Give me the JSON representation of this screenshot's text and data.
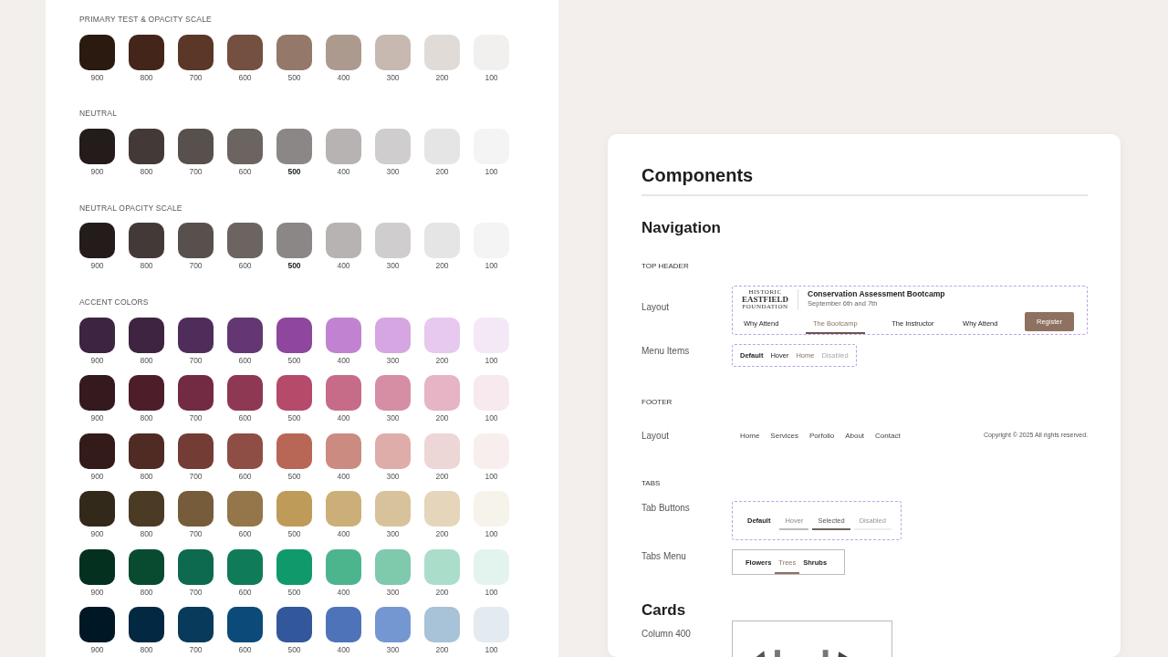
{
  "palette": [
    {
      "title": "PRIMARY  TEST & OPACITY SCALE",
      "rows": [
        [
          {
            "label": "900",
            "color": "#2b1a10",
            "bold": false
          },
          {
            "label": "800",
            "color": "#432619",
            "bold": false
          },
          {
            "label": "700",
            "color": "#5a3726",
            "bold": false
          },
          {
            "label": "600",
            "color": "#73503f",
            "bold": false
          },
          {
            "label": "500",
            "color": "#94786a",
            "bold": false
          },
          {
            "label": "400",
            "color": "#ad9a8e",
            "bold": false
          },
          {
            "label": "300",
            "color": "#c7b9b0",
            "bold": false
          },
          {
            "label": "200",
            "color": "#e0dbd7",
            "bold": false
          },
          {
            "label": "100",
            "color": "#f1f0ef",
            "bold": false
          }
        ]
      ]
    },
    {
      "title": "NEUTRAL",
      "rows": [
        [
          {
            "label": "900",
            "color": "#241c1b",
            "bold": false
          },
          {
            "label": "800",
            "color": "#433a38",
            "bold": false
          },
          {
            "label": "700",
            "color": "#58504d",
            "bold": false
          },
          {
            "label": "600",
            "color": "#6b6461",
            "bold": false
          },
          {
            "label": "500",
            "color": "#8b8786",
            "bold": true
          },
          {
            "label": "400",
            "color": "#b6b3b2",
            "bold": false
          },
          {
            "label": "300",
            "color": "#cfcdcd",
            "bold": false
          },
          {
            "label": "200",
            "color": "#e6e5e6",
            "bold": false
          },
          {
            "label": "100",
            "color": "#f5f4f5",
            "bold": false
          }
        ]
      ]
    },
    {
      "title": "NEUTRAL OPACITY SCALE",
      "rows": [
        [
          {
            "label": "900",
            "color": "#241c1b",
            "bold": false
          },
          {
            "label": "800",
            "color": "#433a38",
            "bold": false
          },
          {
            "label": "700",
            "color": "#58504d",
            "bold": false
          },
          {
            "label": "600",
            "color": "#6b6461",
            "bold": false
          },
          {
            "label": "500",
            "color": "#8b8786",
            "bold": true
          },
          {
            "label": "400",
            "color": "#b6b3b2",
            "bold": false
          },
          {
            "label": "300",
            "color": "#cfcdcd",
            "bold": false
          },
          {
            "label": "200",
            "color": "#e6e5e6",
            "bold": false
          },
          {
            "label": "100",
            "color": "#f5f4f5",
            "bold": false
          }
        ]
      ]
    },
    {
      "title": "ACCENT COLORS",
      "rows": [
        [
          {
            "label": "900",
            "color": "#3d2440",
            "bold": false
          },
          {
            "label": "800",
            "color": "#3e2440",
            "bold": false
          },
          {
            "label": "700",
            "color": "#4f2d5b",
            "bold": false
          },
          {
            "label": "600",
            "color": "#653772",
            "bold": false
          },
          {
            "label": "500",
            "color": "#8e479c",
            "bold": false
          },
          {
            "label": "400",
            "color": "#c183d1",
            "bold": false
          },
          {
            "label": "300",
            "color": "#d6a6e2",
            "bold": false
          },
          {
            "label": "200",
            "color": "#e7c8ef",
            "bold": false
          },
          {
            "label": "100",
            "color": "#f4e8f7",
            "bold": false
          }
        ],
        [
          {
            "label": "900",
            "color": "#34191f",
            "bold": false
          },
          {
            "label": "800",
            "color": "#4d1e29",
            "bold": false
          },
          {
            "label": "700",
            "color": "#722b42",
            "bold": false
          },
          {
            "label": "600",
            "color": "#8e3853",
            "bold": false
          },
          {
            "label": "500",
            "color": "#b54a6a",
            "bold": false
          },
          {
            "label": "400",
            "color": "#c76c88",
            "bold": false
          },
          {
            "label": "300",
            "color": "#d68ea5",
            "bold": false
          },
          {
            "label": "200",
            "color": "#e6b4c4",
            "bold": false
          },
          {
            "label": "100",
            "color": "#f7e9ee",
            "bold": false
          }
        ],
        [
          {
            "label": "900",
            "color": "#331b1a",
            "bold": false
          },
          {
            "label": "800",
            "color": "#4f2b24",
            "bold": false
          },
          {
            "label": "700",
            "color": "#733c34",
            "bold": false
          },
          {
            "label": "600",
            "color": "#8f4e45",
            "bold": false
          },
          {
            "label": "500",
            "color": "#b86656",
            "bold": false
          },
          {
            "label": "400",
            "color": "#cc8b80",
            "bold": false
          },
          {
            "label": "300",
            "color": "#deadaa",
            "bold": false
          },
          {
            "label": "200",
            "color": "#edd6d6",
            "bold": false
          },
          {
            "label": "100",
            "color": "#f8eeee",
            "bold": false
          }
        ],
        [
          {
            "label": "900",
            "color": "#33291b",
            "bold": false
          },
          {
            "label": "800",
            "color": "#4b3b25",
            "bold": false
          },
          {
            "label": "700",
            "color": "#765c3b",
            "bold": false
          },
          {
            "label": "600",
            "color": "#94764a",
            "bold": false
          },
          {
            "label": "500",
            "color": "#bf9b5a",
            "bold": false
          },
          {
            "label": "400",
            "color": "#ccae78",
            "bold": false
          },
          {
            "label": "300",
            "color": "#d8c29c",
            "bold": false
          },
          {
            "label": "200",
            "color": "#e5d5ba",
            "bold": false
          },
          {
            "label": "100",
            "color": "#f6f3ea",
            "bold": false
          }
        ],
        [
          {
            "label": "900",
            "color": "#04301f",
            "bold": false
          },
          {
            "label": "800",
            "color": "#094b31",
            "bold": false
          },
          {
            "label": "700",
            "color": "#0e6a4f",
            "bold": false
          },
          {
            "label": "600",
            "color": "#0f7b59",
            "bold": false
          },
          {
            "label": "500",
            "color": "#109a6c",
            "bold": false
          },
          {
            "label": "400",
            "color": "#4db58e",
            "bold": false
          },
          {
            "label": "300",
            "color": "#7fc9ad",
            "bold": false
          },
          {
            "label": "200",
            "color": "#aadecb",
            "bold": false
          },
          {
            "label": "100",
            "color": "#e3f4ef",
            "bold": false
          }
        ],
        [
          {
            "label": "900",
            "color": "#001826",
            "bold": false
          },
          {
            "label": "800",
            "color": "#032842",
            "bold": false
          },
          {
            "label": "700",
            "color": "#073a5b",
            "bold": false
          },
          {
            "label": "600",
            "color": "#0b4a79",
            "bold": false
          },
          {
            "label": "500",
            "color": "#33579b",
            "bold": false
          },
          {
            "label": "400",
            "color": "#4e73b8",
            "bold": false
          },
          {
            "label": "300",
            "color": "#7497d2",
            "bold": false
          },
          {
            "label": "200",
            "color": "#a8c2d7",
            "bold": false
          },
          {
            "label": "100",
            "color": "#e3eaf0",
            "bold": false
          }
        ]
      ]
    }
  ],
  "components": {
    "title": "Components",
    "navigation": {
      "heading": "Navigation",
      "top_header": {
        "title": "TOP HEADER",
        "layout": {
          "label": "Layout",
          "logo": {
            "top": "HISTORIC",
            "name": "EASTFIELD",
            "bottom": "FOUNDATION"
          },
          "event_title": "Conservation Assessment Bootcamp",
          "event_date": "September 6th and 7th",
          "menu": [
            {
              "label": "Why Attend",
              "selected": false
            },
            {
              "label": "The Bootcamp",
              "selected": true
            },
            {
              "label": "The Instructor",
              "selected": false
            },
            {
              "label": "Why Attend",
              "selected": false
            }
          ],
          "button": "Register"
        },
        "menu_items": {
          "label": "Menu Items",
          "items": [
            {
              "label": "Default",
              "kind": "default"
            },
            {
              "label": "Hover",
              "kind": "hover"
            },
            {
              "label": "Home",
              "kind": "active"
            },
            {
              "label": "Disabled",
              "kind": "disabled"
            }
          ]
        }
      },
      "footer": {
        "title": "FOOTER",
        "label": "Layout",
        "links": [
          "Home",
          "Services",
          "Porfolio",
          "About",
          "Contact"
        ],
        "copyright": "Copyright © 2025 All rights reserved."
      },
      "tabs": {
        "title": "TABS",
        "tab_buttons": {
          "label": "Tab Buttons",
          "items": [
            {
              "label": "Default",
              "kind": "default"
            },
            {
              "label": "Hover",
              "kind": "hover"
            },
            {
              "label": "Selected",
              "kind": "selected"
            },
            {
              "label": "Disabled",
              "kind": "disabled"
            }
          ]
        },
        "tabs_menu": {
          "label": "Tabs Menu",
          "items": [
            {
              "label": "Flowers",
              "selected": false
            },
            {
              "label": "Trees",
              "selected": true
            },
            {
              "label": "Shrubs",
              "selected": false
            }
          ]
        }
      }
    },
    "cards": {
      "heading": "Cards",
      "label": "Column 400"
    }
  }
}
